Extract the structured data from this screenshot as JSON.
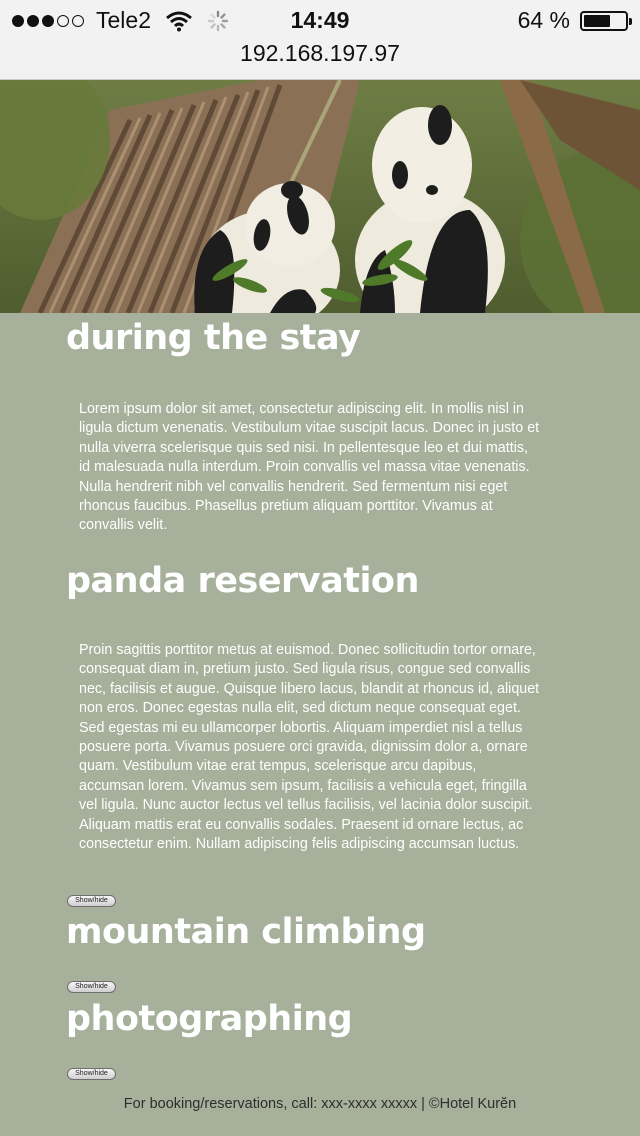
{
  "status_bar": {
    "carrier": "Tele2",
    "time": "14:49",
    "battery": "64 %",
    "battery_level": 0.64,
    "signal_bars_filled": 3,
    "signal_bars_total": 5,
    "icons": [
      "signal-dots-icon",
      "wifi-icon",
      "loading-spinner-icon",
      "battery-icon"
    ]
  },
  "browser": {
    "url": "192.168.197.97"
  },
  "hero": {
    "image": "panda-photo"
  },
  "sections": [
    {
      "title": "during the stay",
      "text": "Lorem ipsum dolor sit amet, consectetur adipiscing elit. In mollis nisl in ligula dictum venenatis. Vestibulum vitae suscipit lacus. Donec in justo et nulla viverra scelerisque quis sed nisi. In pellentesque leo et dui mattis, id malesuada nulla interdum. Proin convallis vel massa vitae venenatis. Nulla hendrerit nibh vel convallis hendrerit. Sed fermentum nisi eget rhoncus faucibus. Phasellus pretium aliquam porttitor. Vivamus at convallis velit."
    },
    {
      "title": "panda reservation",
      "text": "Proin sagittis porttitor metus at euismod. Donec sollicitudin tortor ornare, consequat diam in, pretium justo. Sed ligula risus, congue sed convallis nec, facilisis et augue. Quisque libero lacus, blandit at rhoncus id, aliquet non eros. Donec egestas nulla elit, sed dictum neque consequat eget. Sed egestas mi eu ullamcorper lobortis. Aliquam imperdiet nisl a tellus posuere porta. Vivamus posuere orci gravida, dignissim dolor a, ornare quam. Vestibulum vitae erat tempus, scelerisque arcu dapibus, accumsan lorem. Vivamus sem ipsum, facilisis a vehicula eget, fringilla vel ligula. Nunc auctor lectus vel tellus facilisis, vel lacinia dolor suscipit. Aliquam mattis erat eu convallis sodales. Praesent id ornare lectus, ac consectetur enim. Nullam adipiscing felis adipiscing accumsan luctus.",
      "button": "Show/hide"
    },
    {
      "title": "mountain climbing",
      "button": "Show/hide"
    },
    {
      "title": "photographing",
      "button": "Show/hide"
    }
  ],
  "footer": {
    "text": "For booking/reservations, call: xxx-xxxx xxxxx | ©Hotel Kurĕn"
  },
  "colors": {
    "page_background": "#a7b09a",
    "heading_text": "#ffffff",
    "body_text": "#ffffff",
    "footer_text": "#2e2e2e",
    "chrome_background": "#f2f2f2"
  }
}
